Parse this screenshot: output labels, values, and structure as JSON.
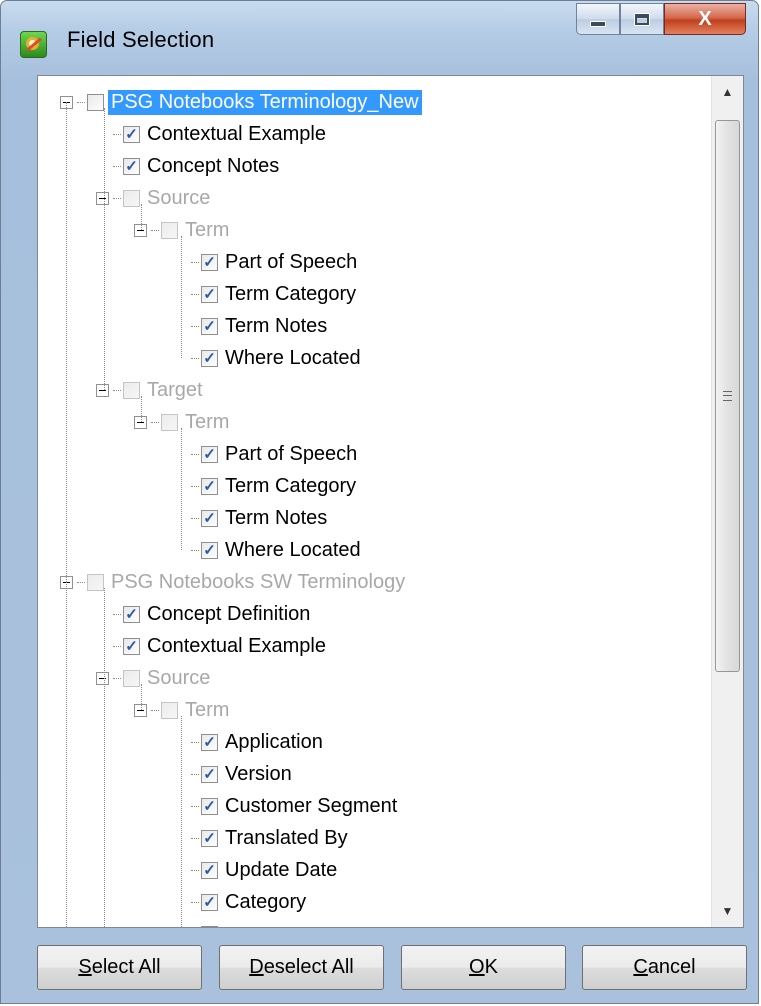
{
  "window": {
    "title": "Field Selection",
    "caption": {
      "minimize": "minimize",
      "maximize": "maximize",
      "close": "X"
    }
  },
  "tree": {
    "nodes": [
      {
        "label": "PSG Notebooks Terminology_New",
        "checked": false,
        "disabled": false,
        "selected": true,
        "expander": true,
        "level": 0
      },
      {
        "label": "Contextual Example",
        "checked": true,
        "disabled": false,
        "expander": false,
        "level": 1
      },
      {
        "label": "Concept Notes",
        "checked": true,
        "disabled": false,
        "expander": false,
        "level": 1
      },
      {
        "label": "Source",
        "checked": false,
        "disabled": true,
        "expander": true,
        "level": 1
      },
      {
        "label": "Term",
        "checked": false,
        "disabled": true,
        "expander": true,
        "level": 2
      },
      {
        "label": "Part of Speech",
        "checked": true,
        "disabled": false,
        "expander": false,
        "level": 3
      },
      {
        "label": "Term Category",
        "checked": true,
        "disabled": false,
        "expander": false,
        "level": 3
      },
      {
        "label": "Term Notes",
        "checked": true,
        "disabled": false,
        "expander": false,
        "level": 3
      },
      {
        "label": "Where Located",
        "checked": true,
        "disabled": false,
        "expander": false,
        "level": 3
      },
      {
        "label": "Target",
        "checked": false,
        "disabled": true,
        "expander": true,
        "level": 1
      },
      {
        "label": "Term",
        "checked": false,
        "disabled": true,
        "expander": true,
        "level": 2
      },
      {
        "label": "Part of Speech",
        "checked": true,
        "disabled": false,
        "expander": false,
        "level": 3
      },
      {
        "label": "Term Category",
        "checked": true,
        "disabled": false,
        "expander": false,
        "level": 3
      },
      {
        "label": "Term Notes",
        "checked": true,
        "disabled": false,
        "expander": false,
        "level": 3
      },
      {
        "label": "Where Located",
        "checked": true,
        "disabled": false,
        "expander": false,
        "level": 3
      },
      {
        "label": "PSG Notebooks SW Terminology",
        "checked": false,
        "disabled": true,
        "expander": true,
        "level": 0
      },
      {
        "label": "Concept Definition",
        "checked": true,
        "disabled": false,
        "expander": false,
        "level": 1
      },
      {
        "label": "Contextual Example",
        "checked": true,
        "disabled": false,
        "expander": false,
        "level": 1
      },
      {
        "label": "Source",
        "checked": false,
        "disabled": true,
        "expander": true,
        "level": 1
      },
      {
        "label": "Term",
        "checked": false,
        "disabled": true,
        "expander": true,
        "level": 2
      },
      {
        "label": "Application",
        "checked": true,
        "disabled": false,
        "expander": false,
        "level": 3
      },
      {
        "label": "Version",
        "checked": true,
        "disabled": false,
        "expander": false,
        "level": 3
      },
      {
        "label": "Customer Segment",
        "checked": true,
        "disabled": false,
        "expander": false,
        "level": 3
      },
      {
        "label": "Translated By",
        "checked": true,
        "disabled": false,
        "expander": false,
        "level": 3
      },
      {
        "label": "Update Date",
        "checked": true,
        "disabled": false,
        "expander": false,
        "level": 3
      },
      {
        "label": "Category",
        "checked": true,
        "disabled": false,
        "expander": false,
        "level": 3
      }
    ]
  },
  "buttons": {
    "select_all": {
      "accel": "S",
      "rest": "elect All"
    },
    "deselect_all": {
      "accel": "D",
      "rest": "eselect All"
    },
    "ok": {
      "accel": "O",
      "rest": "K"
    },
    "cancel": {
      "accel": "C",
      "rest": "ancel"
    }
  },
  "colors": {
    "selection": "#3399ff",
    "disabled_text": "#a8a8a8",
    "check": "#2a5aa8",
    "frame": "#a9c1dc"
  },
  "icons": {
    "app": "field-selection-app-icon",
    "check": "checkmark-icon",
    "expander": "minus-box-icon"
  }
}
